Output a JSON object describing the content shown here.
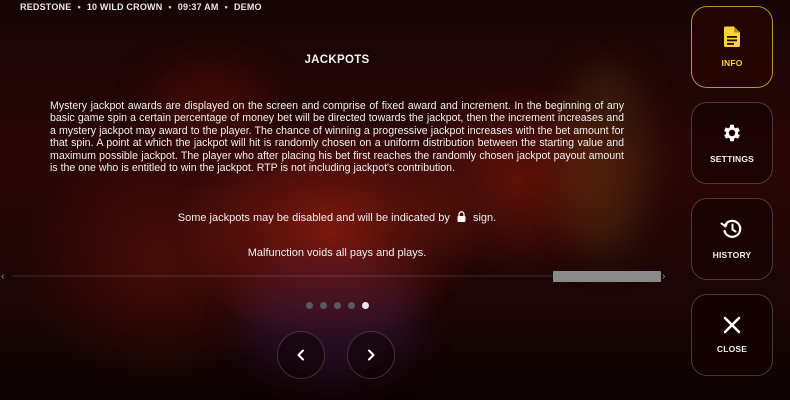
{
  "statusbar": {
    "brand": "REDSTONE",
    "game": "10 WILD CROWN",
    "time": "09:37 AM",
    "mode": "DEMO"
  },
  "page": {
    "title": "JACKPOTS",
    "paragraph": "Mystery jackpot awards are displayed on the screen and comprise of fixed award and increment. In the beginning of any basic game spin a certain percentage of money bet will be directed towards the jackpot, then the increment increases and a mystery jackpot may award to the player. The chance of winning a progressive jackpot increases with the bet amount for that spin. A point at which the jackpot will hit is randomly chosen on a uniform distribution between the starting value and maximum possible jackpot. The player who after placing his bet first reaches the randomly chosen jackpot payout amount is the one who is entitled to win the jackpot. RTP is not including jackpot's contribution.",
    "disabled_note_before": "Some jackpots may be disabled and will be indicated by",
    "disabled_note_after": "sign.",
    "malfunction": "Malfunction voids all pays and plays."
  },
  "pagination": {
    "total": 5,
    "current": 5
  },
  "nav": {
    "prev_icon": "chevron-left-icon",
    "next_icon": "chevron-right-icon"
  },
  "sidebar": {
    "items": [
      {
        "label": "INFO",
        "icon": "document-icon",
        "active": true
      },
      {
        "label": "SETTINGS",
        "icon": "gear-icon",
        "active": false
      },
      {
        "label": "HISTORY",
        "icon": "history-icon",
        "active": false
      },
      {
        "label": "CLOSE",
        "icon": "close-icon",
        "active": false
      }
    ]
  },
  "colors": {
    "accent": "#ffd23a",
    "background": "#2a0707"
  }
}
